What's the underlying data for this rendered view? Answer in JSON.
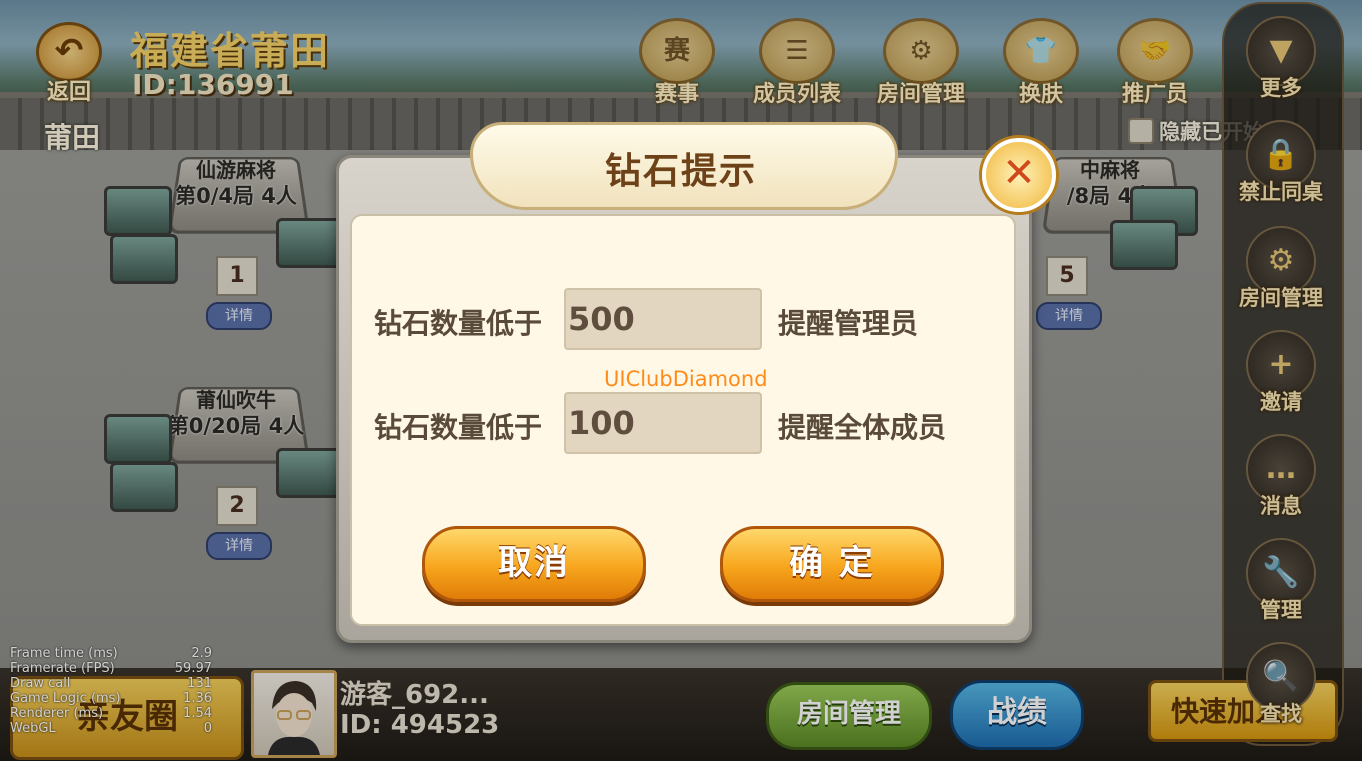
{
  "header": {
    "back_label": "返回",
    "club_name": "福建省莆田",
    "club_id": "ID:136991",
    "region": "莆田",
    "hide_toggle_label": "隐藏已开始"
  },
  "top_menu": [
    {
      "label": "赛事",
      "icon": "trophy-badge-icon",
      "glyph": "赛"
    },
    {
      "label": "成员列表",
      "icon": "list-icon",
      "glyph": "☰"
    },
    {
      "label": "房间管理",
      "icon": "user-gear-icon",
      "glyph": "⚙"
    },
    {
      "label": "换肤",
      "icon": "shirt-icon",
      "glyph": "👕"
    },
    {
      "label": "推广员",
      "icon": "handshake-icon",
      "glyph": "🤝"
    }
  ],
  "sidebar": [
    {
      "label": "更多",
      "icon": "triangle-down-icon",
      "glyph": "▼"
    },
    {
      "label": "禁止同桌",
      "icon": "lock-icon",
      "glyph": "🔒"
    },
    {
      "label": "房间管理",
      "icon": "user-gear-icon",
      "glyph": "⚙"
    },
    {
      "label": "邀请",
      "icon": "user-plus-icon",
      "glyph": "+"
    },
    {
      "label": "消息",
      "icon": "chat-bubble-icon",
      "glyph": "…"
    },
    {
      "label": "管理",
      "icon": "wrench-icon",
      "glyph": "🔧"
    },
    {
      "label": "查找",
      "icon": "magnifier-icon",
      "glyph": "🔍"
    }
  ],
  "tables": [
    {
      "name": "仙游麻将",
      "rounds": "第0/4局  4人",
      "number": "1",
      "detail": "详情"
    },
    {
      "name": "莆仙吹牛",
      "rounds": "第0/20局  4人",
      "number": "2",
      "detail": "详情"
    },
    {
      "name": "中麻将",
      "rounds": "/8局  4人",
      "number": "5",
      "detail": "详情"
    }
  ],
  "dialog": {
    "title": "钻石提示",
    "close_icon": "close-x-icon",
    "row1_label": "钻石数量低于",
    "row1_value": "500",
    "row1_suffix": "提醒管理员",
    "row2_label": "钻石数量低于",
    "row2_value": "100",
    "row2_suffix": "提醒全体成员",
    "debug_label": "UIClubDiamond",
    "cancel_label": "取消",
    "confirm_label": "确 定"
  },
  "bottom_bar": {
    "friends_label": "亲友圈",
    "player_name": "游客_692...",
    "player_id": "ID: 494523",
    "room_manage_label": "房间管理",
    "record_label": "战绩",
    "quick_join_label": "快速加入"
  },
  "debug_stats": [
    {
      "k": "Frame time (ms)",
      "v": "2.9"
    },
    {
      "k": "Framerate (FPS)",
      "v": "59.97"
    },
    {
      "k": "Draw call",
      "v": "131"
    },
    {
      "k": "Game Logic (ms)",
      "v": "1.36"
    },
    {
      "k": "Renderer (ms)",
      "v": "1.54"
    },
    {
      "k": "WebGL",
      "v": "0"
    }
  ],
  "colors": {
    "accent_gold": "#f7a51c",
    "title_brown": "#6d4218",
    "debug_orange": "#ff8c1a",
    "record_blue": "#1f6fb2",
    "room_green": "#5c8a26"
  }
}
